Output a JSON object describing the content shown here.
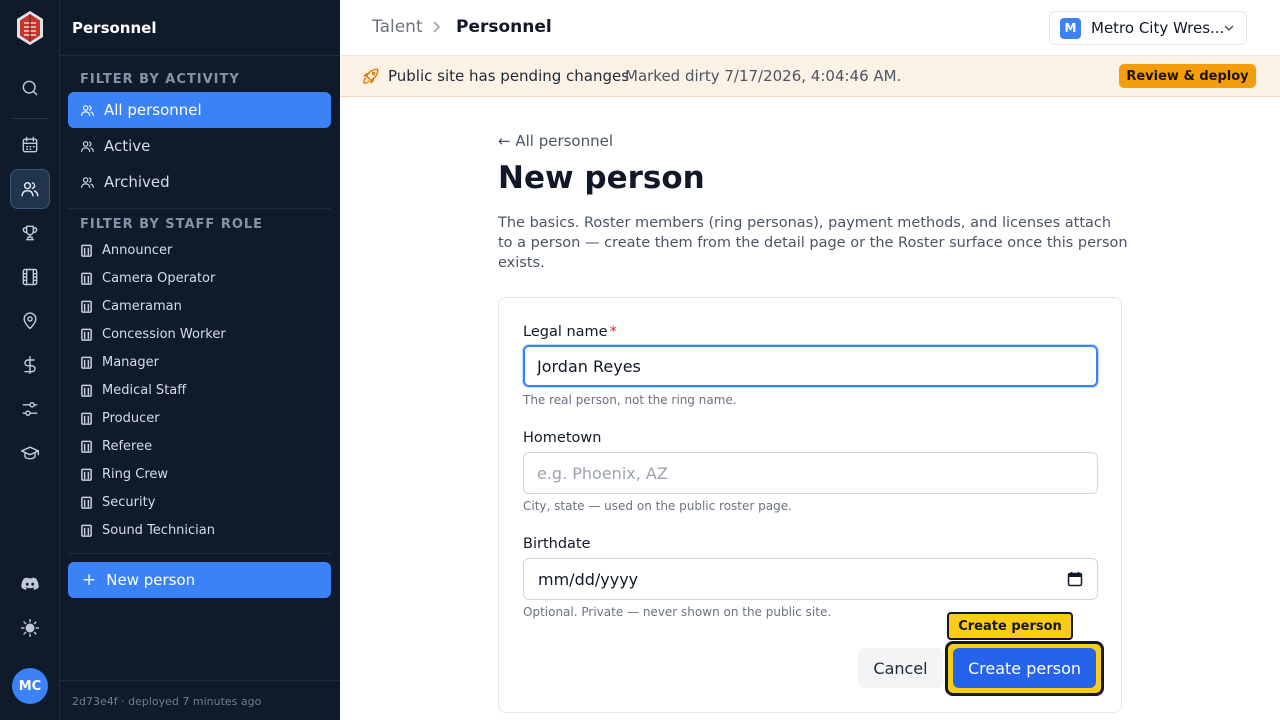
{
  "app": {
    "brand": "logo",
    "accent": "#3b82f6",
    "user_initials": "MC"
  },
  "rail": [
    {
      "icon": "search-icon"
    },
    {
      "icon": "calendar-icon"
    },
    {
      "icon": "users-icon",
      "active": true
    },
    {
      "icon": "trophy-icon"
    },
    {
      "icon": "film-icon"
    },
    {
      "icon": "map-pin-icon"
    },
    {
      "icon": "dollar-icon"
    },
    {
      "icon": "sliders-icon"
    },
    {
      "icon": "graduation-cap-icon"
    },
    {
      "icon": "discord-icon"
    },
    {
      "icon": "sun-icon"
    }
  ],
  "sidebar": {
    "title": "Personnel",
    "activity_heading": "FILTER BY ACTIVITY",
    "activity": [
      {
        "label": "All personnel",
        "active": true
      },
      {
        "label": "Active"
      },
      {
        "label": "Archived"
      }
    ],
    "role_heading": "FILTER BY STAFF ROLE",
    "roles": [
      "Announcer",
      "Camera Operator",
      "Cameraman",
      "Concession Worker",
      "Manager",
      "Medical Staff",
      "Producer",
      "Referee",
      "Ring Crew",
      "Security",
      "Sound Technician"
    ],
    "new_button": "New person",
    "footer": "2d73e4f · deployed 7 minutes ago"
  },
  "header": {
    "breadcrumb_parent": "Talent",
    "breadcrumb_current": "Personnel",
    "org_initial": "M",
    "org_name": "Metro City Wres..."
  },
  "banner": {
    "title": "Public site has pending changes",
    "subtitle": "Marked dirty 7/17/2026, 4:04:46 AM.",
    "action": "Review & deploy",
    "color": "#fbf1e4"
  },
  "page": {
    "back_link": "← All personnel",
    "title": "New person",
    "description": "The basics. Roster members (ring personas), payment methods, and licenses attach to a person — create them from the detail page or the Roster surface once this person exists."
  },
  "form": {
    "legal_name": {
      "label": "Legal name",
      "required_mark": "*",
      "value": "Jordan Reyes",
      "help": "The real person, not the ring name."
    },
    "hometown": {
      "label": "Hometown",
      "placeholder": "e.g. Phoenix, AZ",
      "help": "City, state — used on the public roster page."
    },
    "birthdate": {
      "label": "Birthdate",
      "value": "mm/dd/yyyy",
      "help": "Optional. Private — never shown on the public site."
    },
    "cancel": "Cancel",
    "submit": "Create person",
    "tooltip": "Create person"
  }
}
